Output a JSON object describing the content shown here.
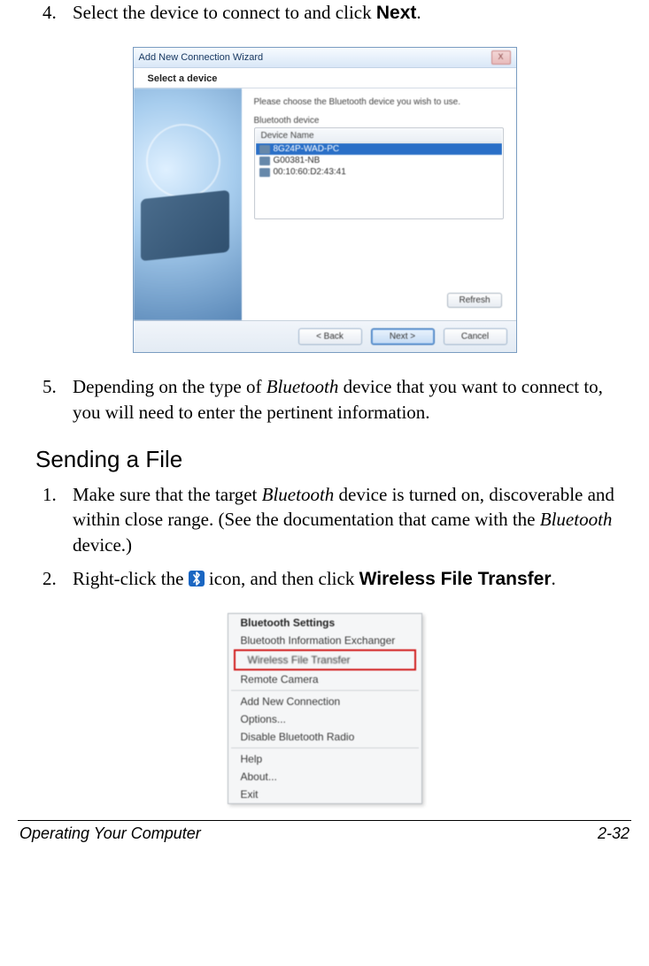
{
  "steps_a": [
    {
      "num": "4.",
      "pre": "Select the device to connect to and click ",
      "bold": "Next",
      "post": "."
    }
  ],
  "wizard": {
    "title": "Add New Connection Wizard",
    "close": "X",
    "select_label": "Select a device",
    "instruction": "Please choose the Bluetooth device you wish to use.",
    "group_label": "Bluetooth device",
    "col_header": "Device Name",
    "rows": [
      {
        "label": "8G24P-WAD-PC",
        "selected": true
      },
      {
        "label": "G00381-NB",
        "selected": false
      },
      {
        "label": "00:10:60:D2:43:41",
        "selected": false
      }
    ],
    "refresh": "Refresh",
    "back": "< Back",
    "next": "Next >",
    "cancel": "Cancel"
  },
  "steps_b": [
    {
      "num": "5.",
      "parts": [
        {
          "t": "Depending on the type of "
        },
        {
          "t": "Bluetooth",
          "style": "ital"
        },
        {
          "t": " device that you want to connect to, you will need to enter the pertinent information."
        }
      ]
    }
  ],
  "section_heading": "Sending a File",
  "steps_c": [
    {
      "num": "1.",
      "parts": [
        {
          "t": "Make sure that the target "
        },
        {
          "t": "Bluetooth",
          "style": "ital"
        },
        {
          "t": " device is turned on, discoverable and within close range. (See the documentation that came with the "
        },
        {
          "t": "Bluetooth",
          "style": "ital"
        },
        {
          "t": " device.)"
        }
      ]
    },
    {
      "num": "2.",
      "parts": [
        {
          "t": "Right-click the "
        },
        {
          "t": "ICON",
          "style": "icon"
        },
        {
          "t": " icon, and then click "
        },
        {
          "t": "Wireless File Transfer",
          "style": "bold"
        },
        {
          "t": "."
        }
      ]
    }
  ],
  "context_menu": {
    "items": [
      {
        "label": "Bluetooth Settings",
        "bold": true
      },
      {
        "label": "Bluetooth Information Exchanger"
      },
      {
        "label": "Wireless File Transfer",
        "highlight": true
      },
      {
        "label": "Remote Camera"
      },
      {
        "sep": true
      },
      {
        "label": "Add New Connection"
      },
      {
        "label": "Options..."
      },
      {
        "label": "Disable Bluetooth Radio"
      },
      {
        "sep": true
      },
      {
        "label": "Help"
      },
      {
        "label": "About..."
      },
      {
        "label": "Exit"
      }
    ]
  },
  "footer": {
    "left": "Operating Your Computer",
    "right": "2-32"
  }
}
